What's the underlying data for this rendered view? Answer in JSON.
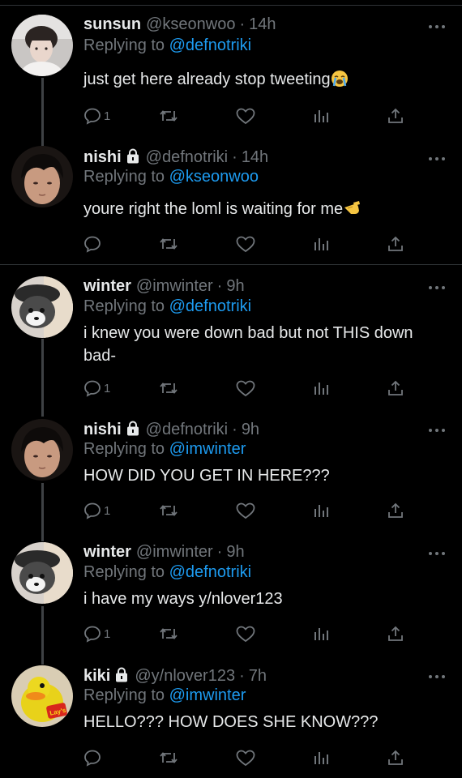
{
  "tweets": [
    {
      "name": "sunsun",
      "locked": false,
      "handle": "@kseonwoo",
      "time": "14h",
      "replying_prefix": "Replying to",
      "replying_to": "@defnotriki",
      "text": "just get here already stop tweeting",
      "emoji": "loudly-crying-face-emoji",
      "reply_count": "1"
    },
    {
      "name": "nishi",
      "locked": true,
      "handle": "@defnotriki",
      "time": "14h",
      "replying_prefix": "Replying to",
      "replying_to": "@kseonwoo",
      "text": "youre right the loml is waiting for me",
      "emoji": "saluting-hand-emoji",
      "reply_count": ""
    },
    {
      "name": "winter",
      "locked": false,
      "handle": "@imwinter",
      "time": "9h",
      "replying_prefix": "Replying to",
      "replying_to": "@defnotriki",
      "text": "i knew you were down bad but not THIS down bad-",
      "reply_count": "1"
    },
    {
      "name": "nishi",
      "locked": true,
      "handle": "@defnotriki",
      "time": "9h",
      "replying_prefix": "Replying to",
      "replying_to": "@imwinter",
      "text": "HOW DID YOU GET IN HERE???",
      "reply_count": "1"
    },
    {
      "name": "winter",
      "locked": false,
      "handle": "@imwinter",
      "time": "9h",
      "replying_prefix": "Replying to",
      "replying_to": "@defnotriki",
      "text": "i have my ways y/nlover123",
      "reply_count": "1"
    },
    {
      "name": "kiki",
      "locked": true,
      "handle": "@y/nlover123",
      "time": "7h",
      "replying_prefix": "Replying to",
      "replying_to": "@imwinter",
      "text": "HELLO??? HOW DOES SHE KNOW???",
      "reply_count": ""
    }
  ],
  "avatar_badge_text": "Lay's",
  "colors": {
    "background": "#000000",
    "text": "#e7e9ea",
    "muted": "#71767b",
    "link": "#1d9bf0",
    "divider": "#2f3336"
  }
}
